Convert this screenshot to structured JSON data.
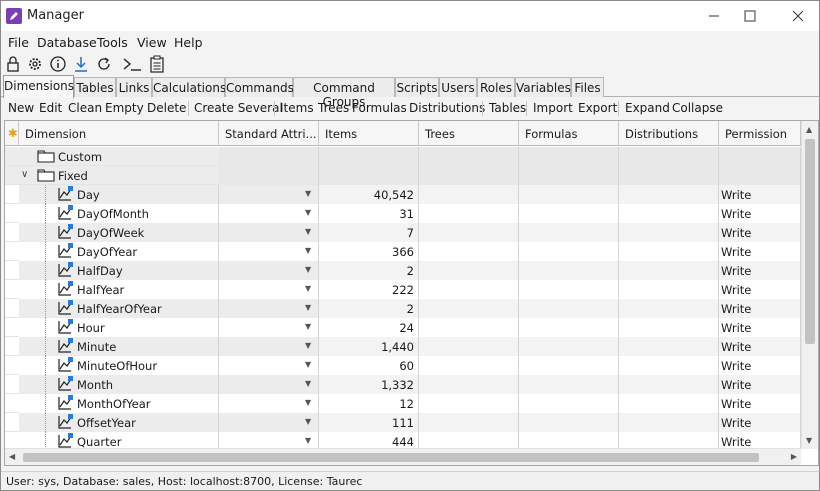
{
  "window": {
    "title": "Manager"
  },
  "menu": [
    "File",
    "Database",
    "Tools",
    "View",
    "Help"
  ],
  "toolbar_icons": [
    "lock-icon",
    "gear-icon",
    "info-icon",
    "download-icon",
    "refresh-icon",
    "terminal-icon",
    "clipboard-icon"
  ],
  "tabs": [
    "Dimensions",
    "Tables",
    "Links",
    "Calculations",
    "Commands",
    "Command Groups",
    "Scripts",
    "Users",
    "Roles",
    "Variables",
    "Files"
  ],
  "active_tab": "Dimensions",
  "actions": {
    "new": "New",
    "edit": "Edit",
    "clean": "Clean",
    "empty": "Empty",
    "delete": "Delete",
    "create_several": "Create Several",
    "items": "Items",
    "trees": "Trees",
    "formulas": "Formulas",
    "distributions": "Distributions",
    "tables": "Tables",
    "import": "Import",
    "export": "Export",
    "expand": "Expand",
    "collapse": "Collapse"
  },
  "grid": {
    "columns": [
      "Dimension",
      "Standard Attri...",
      "Items",
      "Trees",
      "Formulas",
      "Distributions",
      "Permission"
    ],
    "folders": [
      {
        "name": "Custom",
        "expanded": false
      },
      {
        "name": "Fixed",
        "expanded": true
      }
    ],
    "rows": [
      {
        "name": "Day",
        "items": "40,542",
        "permission": "Write"
      },
      {
        "name": "DayOfMonth",
        "items": "31",
        "permission": "Write"
      },
      {
        "name": "DayOfWeek",
        "items": "7",
        "permission": "Write"
      },
      {
        "name": "DayOfYear",
        "items": "366",
        "permission": "Write"
      },
      {
        "name": "HalfDay",
        "items": "2",
        "permission": "Write"
      },
      {
        "name": "HalfYear",
        "items": "222",
        "permission": "Write"
      },
      {
        "name": "HalfYearOfYear",
        "items": "2",
        "permission": "Write"
      },
      {
        "name": "Hour",
        "items": "24",
        "permission": "Write"
      },
      {
        "name": "Minute",
        "items": "1,440",
        "permission": "Write"
      },
      {
        "name": "MinuteOfHour",
        "items": "60",
        "permission": "Write"
      },
      {
        "name": "Month",
        "items": "1,332",
        "permission": "Write"
      },
      {
        "name": "MonthOfYear",
        "items": "12",
        "permission": "Write"
      },
      {
        "name": "OffsetYear",
        "items": "111",
        "permission": "Write"
      },
      {
        "name": "Quarter",
        "items": "444",
        "permission": "Write"
      }
    ]
  },
  "status": "User: sys, Database: sales, Host: localhost:8700, License: Taurec",
  "colors": {
    "accent": "#7a3fb0",
    "selected_row": "#e8e8e8",
    "header_marker": "#e8a020"
  }
}
